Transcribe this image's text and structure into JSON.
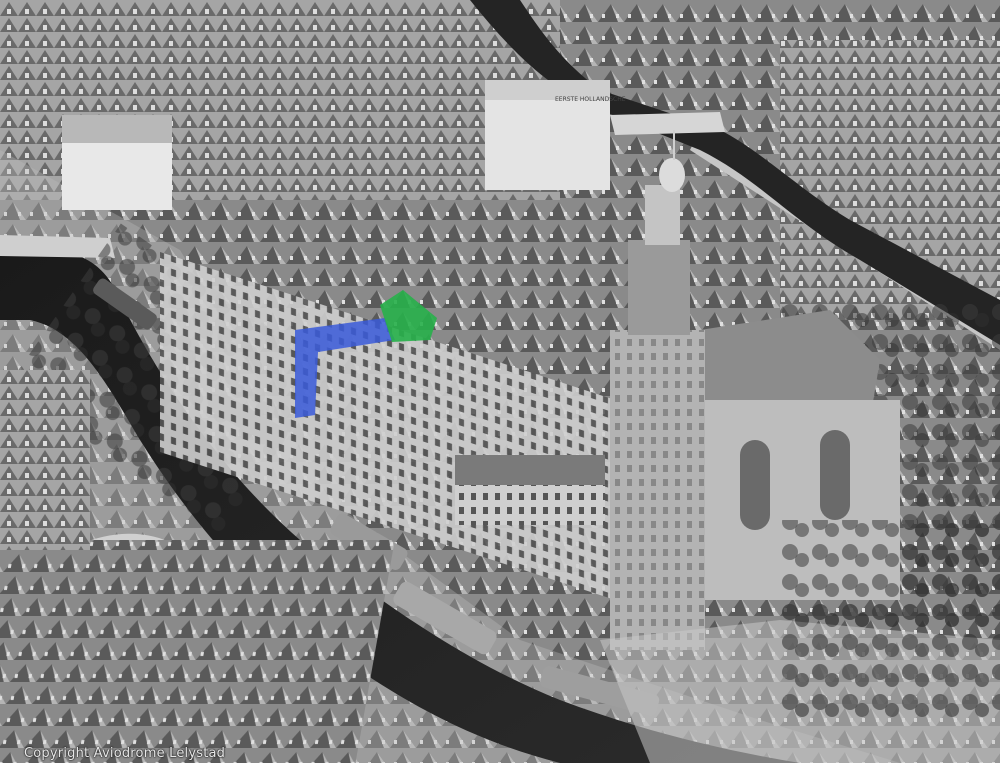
{
  "photo": {
    "credit": "Copyright Aviodrome Lelystad",
    "sign_text": "EERSTE HOLLANDSCHE",
    "highlight_colors": {
      "blue": "#3a5bd9",
      "green": "#27b04a"
    },
    "palette": {
      "water": "#1c1c1c",
      "street": "#bdbdbd",
      "roof_dark": "#4a4a4a",
      "roof_light": "#9a9a9a",
      "facade": "#d9d9d9"
    }
  }
}
